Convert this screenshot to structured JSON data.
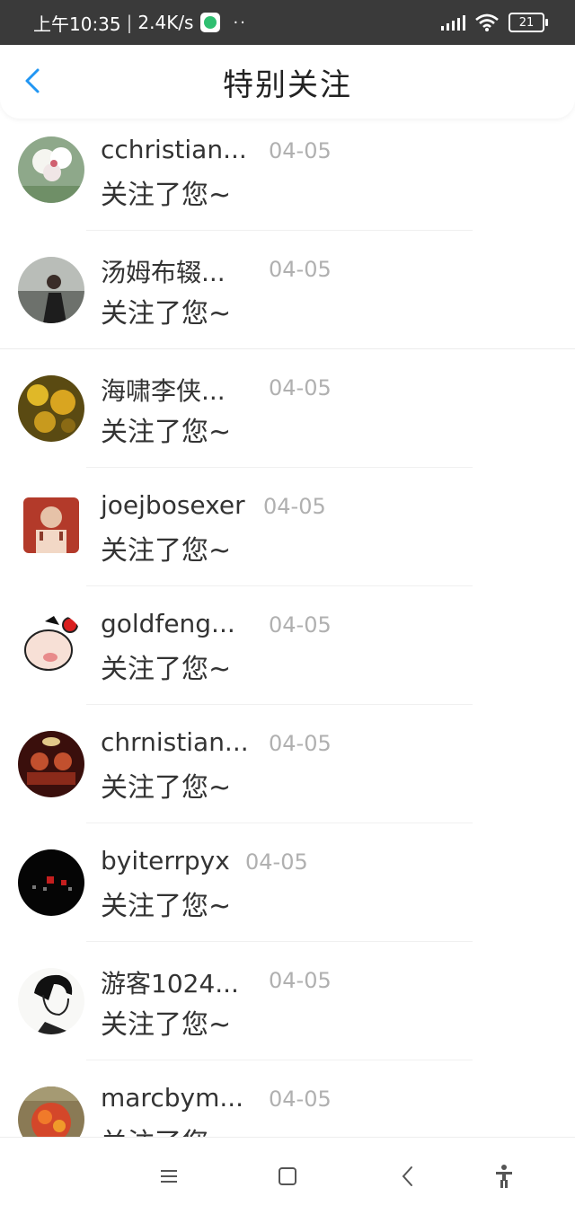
{
  "status_bar": {
    "time": "上午10:35",
    "speed": "2.4K/s",
    "dots": "··",
    "battery": "21"
  },
  "header": {
    "title": "特别关注"
  },
  "items": [
    {
      "name": "cchristian...",
      "date": "04-05",
      "message": "关注了您~"
    },
    {
      "name": "汤姆布辍...",
      "date": "04-05",
      "message": "关注了您~"
    },
    {
      "name": "海啸李侠...",
      "date": "04-05",
      "message": "关注了您~"
    },
    {
      "name": "joejbosexer",
      "date": "04-05",
      "message": "关注了您~"
    },
    {
      "name": "goldfeng...",
      "date": "04-05",
      "message": "关注了您~"
    },
    {
      "name": "chrnistian...",
      "date": "04-05",
      "message": "关注了您~"
    },
    {
      "name": "byiterrpyx",
      "date": "04-05",
      "message": "关注了您~"
    },
    {
      "name": "游客1024...",
      "date": "04-05",
      "message": "关注了您~"
    },
    {
      "name": "marcbym...",
      "date": "04-05",
      "message": "关注了您"
    }
  ],
  "icons": {
    "back": "chevron-left-icon",
    "menu": "menu-icon",
    "home": "square-icon",
    "nav_back": "chevron-left-icon",
    "accessibility": "accessibility-icon"
  },
  "colors": {
    "accent": "#2196f3",
    "status_bar": "#3a3a3a",
    "muted_text": "#b0b0b0",
    "text": "#333333"
  }
}
